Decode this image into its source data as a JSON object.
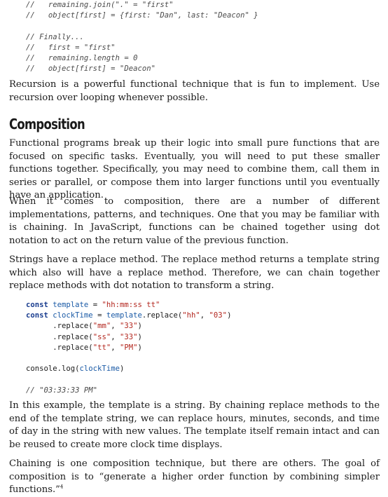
{
  "code_top": {
    "lines": [
      "//   remaining.join(\".\" = \"first\"",
      "//   object[first] = {first: \"Dan\", last: \"Deacon\" }",
      "",
      "// Finally...",
      "//   first = \"first\"",
      "//   remaining.length = 0",
      "//   object[first] = \"Deacon\""
    ]
  },
  "paragraphs": {
    "recursion": "Recursion is a powerful functional technique that is fun to implement. Use recursion over looping whenever possible.",
    "composition_intro": "Functional programs break up their logic into small pure functions that are focused on specific tasks. Eventually, you will need to put these smaller functions together. Specifically, you may need to combine them, call them in series or parallel, or com­pose them into larger functions until you eventually have an application.",
    "chaining_intro": "When it comes to composition, there are a number of different implementations, pat­terns, and techniques. One that you may be familiar with is chaining. In JavaScript, functions can be chained together using dot notation to act on the return value of the previous function.",
    "replace_method": "Strings have a replace method. The replace method returns a template string which also will have a replace method. Therefore, we can chain together replace methods with dot notation to transform a string.",
    "example_explained": "In this example, the template is a string. By chaining replace methods to the end of the template string, we can replace hours, minutes, seconds, and time of day in the string with new values. The template itself remain intact and can be reused to create more clock time displays.",
    "chaining_goal": "Chaining is one composition technique, but there are others. The goal of composition is to “generate a higher order function by combining simpler functions.”",
    "footnote_marker": "4"
  },
  "heading": "Composition",
  "code_example": {
    "kw_const": "const",
    "var_template": "template",
    "eq": " = ",
    "str_template": "\"hh:mm:ss tt\"",
    "var_clock": "clockTime",
    "replace_call": ".replace(",
    "args": [
      [
        "\"hh\"",
        "\"03\""
      ],
      [
        "\"mm\"",
        "\"33\""
      ],
      [
        "\"ss\"",
        "\"33\""
      ],
      [
        "\"tt\"",
        "\"PM\""
      ]
    ],
    "console": "console.log(",
    "result_comment": "// \"03:33:33 PM\""
  }
}
